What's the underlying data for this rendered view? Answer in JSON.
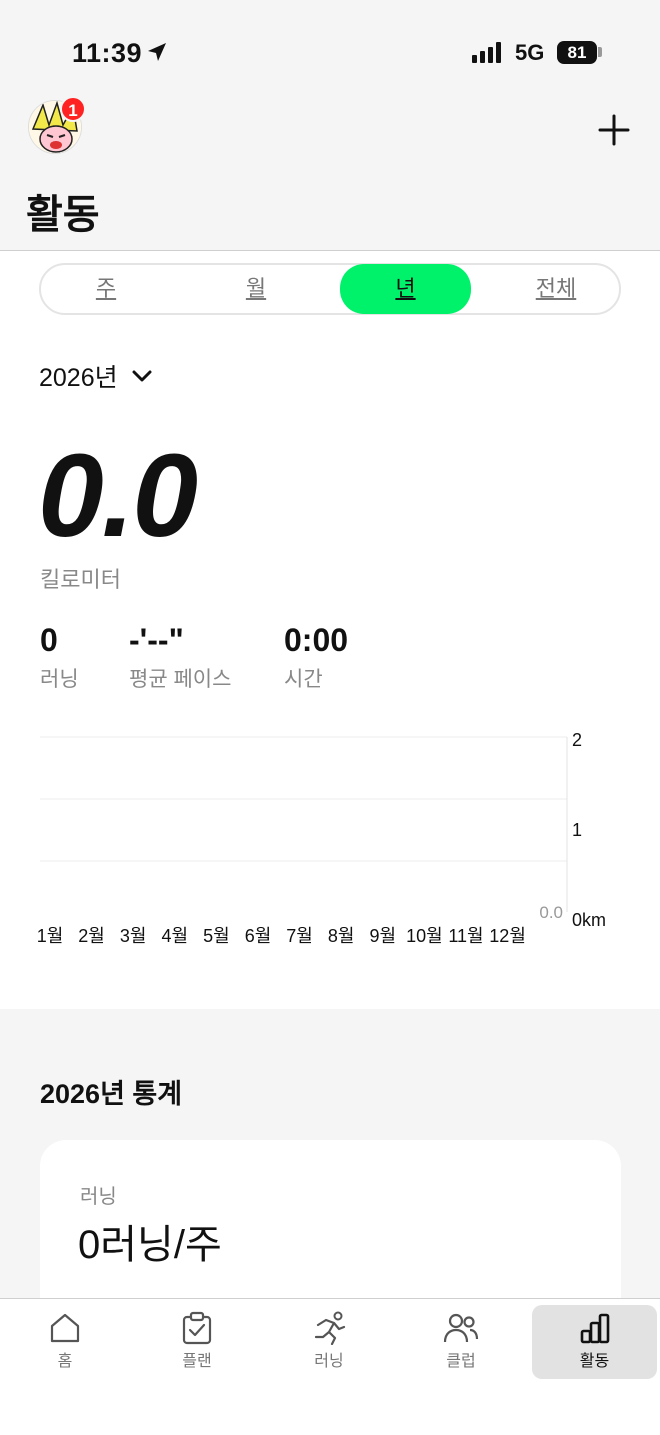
{
  "status_bar": {
    "time": "11:39",
    "network": "5G",
    "battery": "81"
  },
  "header": {
    "title": "활동",
    "badge_count": "1"
  },
  "period_tabs": [
    {
      "label": "주",
      "active": false
    },
    {
      "label": "월",
      "active": false
    },
    {
      "label": "년",
      "active": true
    },
    {
      "label": "전체",
      "active": false
    }
  ],
  "year_selector": {
    "value": "2026년"
  },
  "summary": {
    "distance": "0.0",
    "distance_unit": "킬로미터",
    "runs_value": "0",
    "runs_label": "러닝",
    "pace_value": "-'--\"",
    "pace_label": "평균 페이스",
    "time_value": "0:00",
    "time_label": "시간"
  },
  "chart_data": {
    "type": "bar",
    "categories": [
      "1월",
      "2월",
      "3월",
      "4월",
      "5월",
      "6월",
      "7월",
      "8월",
      "9월",
      "10월",
      "11월",
      "12월"
    ],
    "values": [
      0,
      0,
      0,
      0,
      0,
      0,
      0,
      0,
      0,
      0,
      0,
      0
    ],
    "ylim": [
      0,
      2
    ],
    "y_ticks": [
      "0km",
      "1",
      "2"
    ],
    "value_label": "0.0",
    "grid": true
  },
  "stats_section": {
    "title": "2026년 통계",
    "card_label": "러닝",
    "card_value": "0러닝/주"
  },
  "bottom_nav": [
    {
      "label": "홈",
      "icon": "home-icon",
      "active": false
    },
    {
      "label": "플랜",
      "icon": "clipboard-check-icon",
      "active": false
    },
    {
      "label": "러닝",
      "icon": "runner-icon",
      "active": false
    },
    {
      "label": "클럽",
      "icon": "people-icon",
      "active": false
    },
    {
      "label": "활동",
      "icon": "bar-chart-icon",
      "active": true
    }
  ],
  "colors": {
    "accent": "#00f26a",
    "badge": "#ff2222"
  }
}
